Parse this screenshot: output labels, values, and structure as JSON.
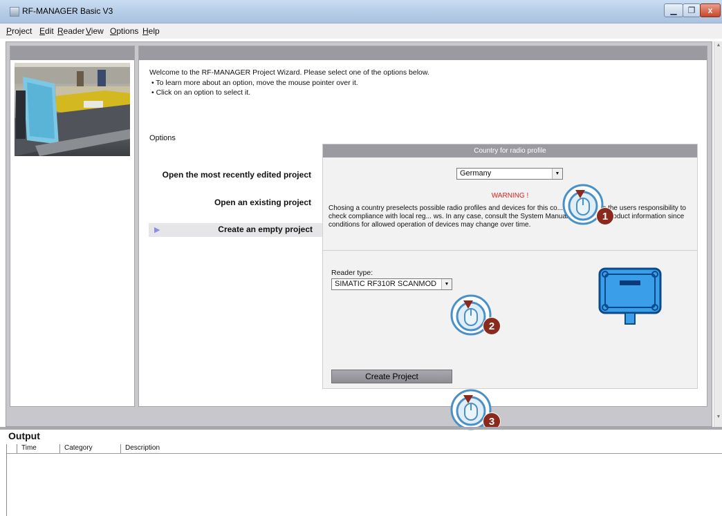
{
  "window": {
    "title": "RF-MANAGER Basic V3",
    "minimize": "▁",
    "maximize": "❐",
    "close": "x"
  },
  "menu": [
    "Project",
    "Edit",
    "Reader",
    "View",
    "Options",
    "Help"
  ],
  "wizard": {
    "welcome": "Welcome to the RF-MANAGER Project Wizard. Please select one of the options below.",
    "bullets": [
      "To learn more about an option, move the mouse pointer over it.",
      "Click on an option to select it."
    ],
    "options_label": "Options",
    "options": [
      "Open the most recently edited project",
      "Open an existing project",
      "Create an empty project"
    ],
    "selected_option": "Create an empty project"
  },
  "country": {
    "header": "Country for radio profile",
    "selected": "Germany",
    "warning_title": "WARNING !",
    "warning_text": "Chosing a country preselects possible radio profiles and devices for this co... However, it is the users responsibility to check compliance with local reg... ws. In any case, consult the System Manual and current product information since conditions for allowed operation of devices may change over time."
  },
  "reader": {
    "label": "Reader type:",
    "selected": "SIMATIC RF310R SCANMOD"
  },
  "create_button": "Create Project",
  "steps": [
    "1",
    "2",
    "3"
  ],
  "output": {
    "title": "Output",
    "columns": [
      "Time",
      "Category",
      "Description"
    ]
  },
  "icons": {
    "step_callout": "mouse-click-icon",
    "reader_device": "rfid-reader-icon"
  },
  "colors": {
    "panel_header": "#9a9aa0",
    "warning": "#e0201a",
    "step_badge": "#8b2a1c",
    "callout_blue": "#4a90c8",
    "device_blue": "#3a9ee8"
  }
}
